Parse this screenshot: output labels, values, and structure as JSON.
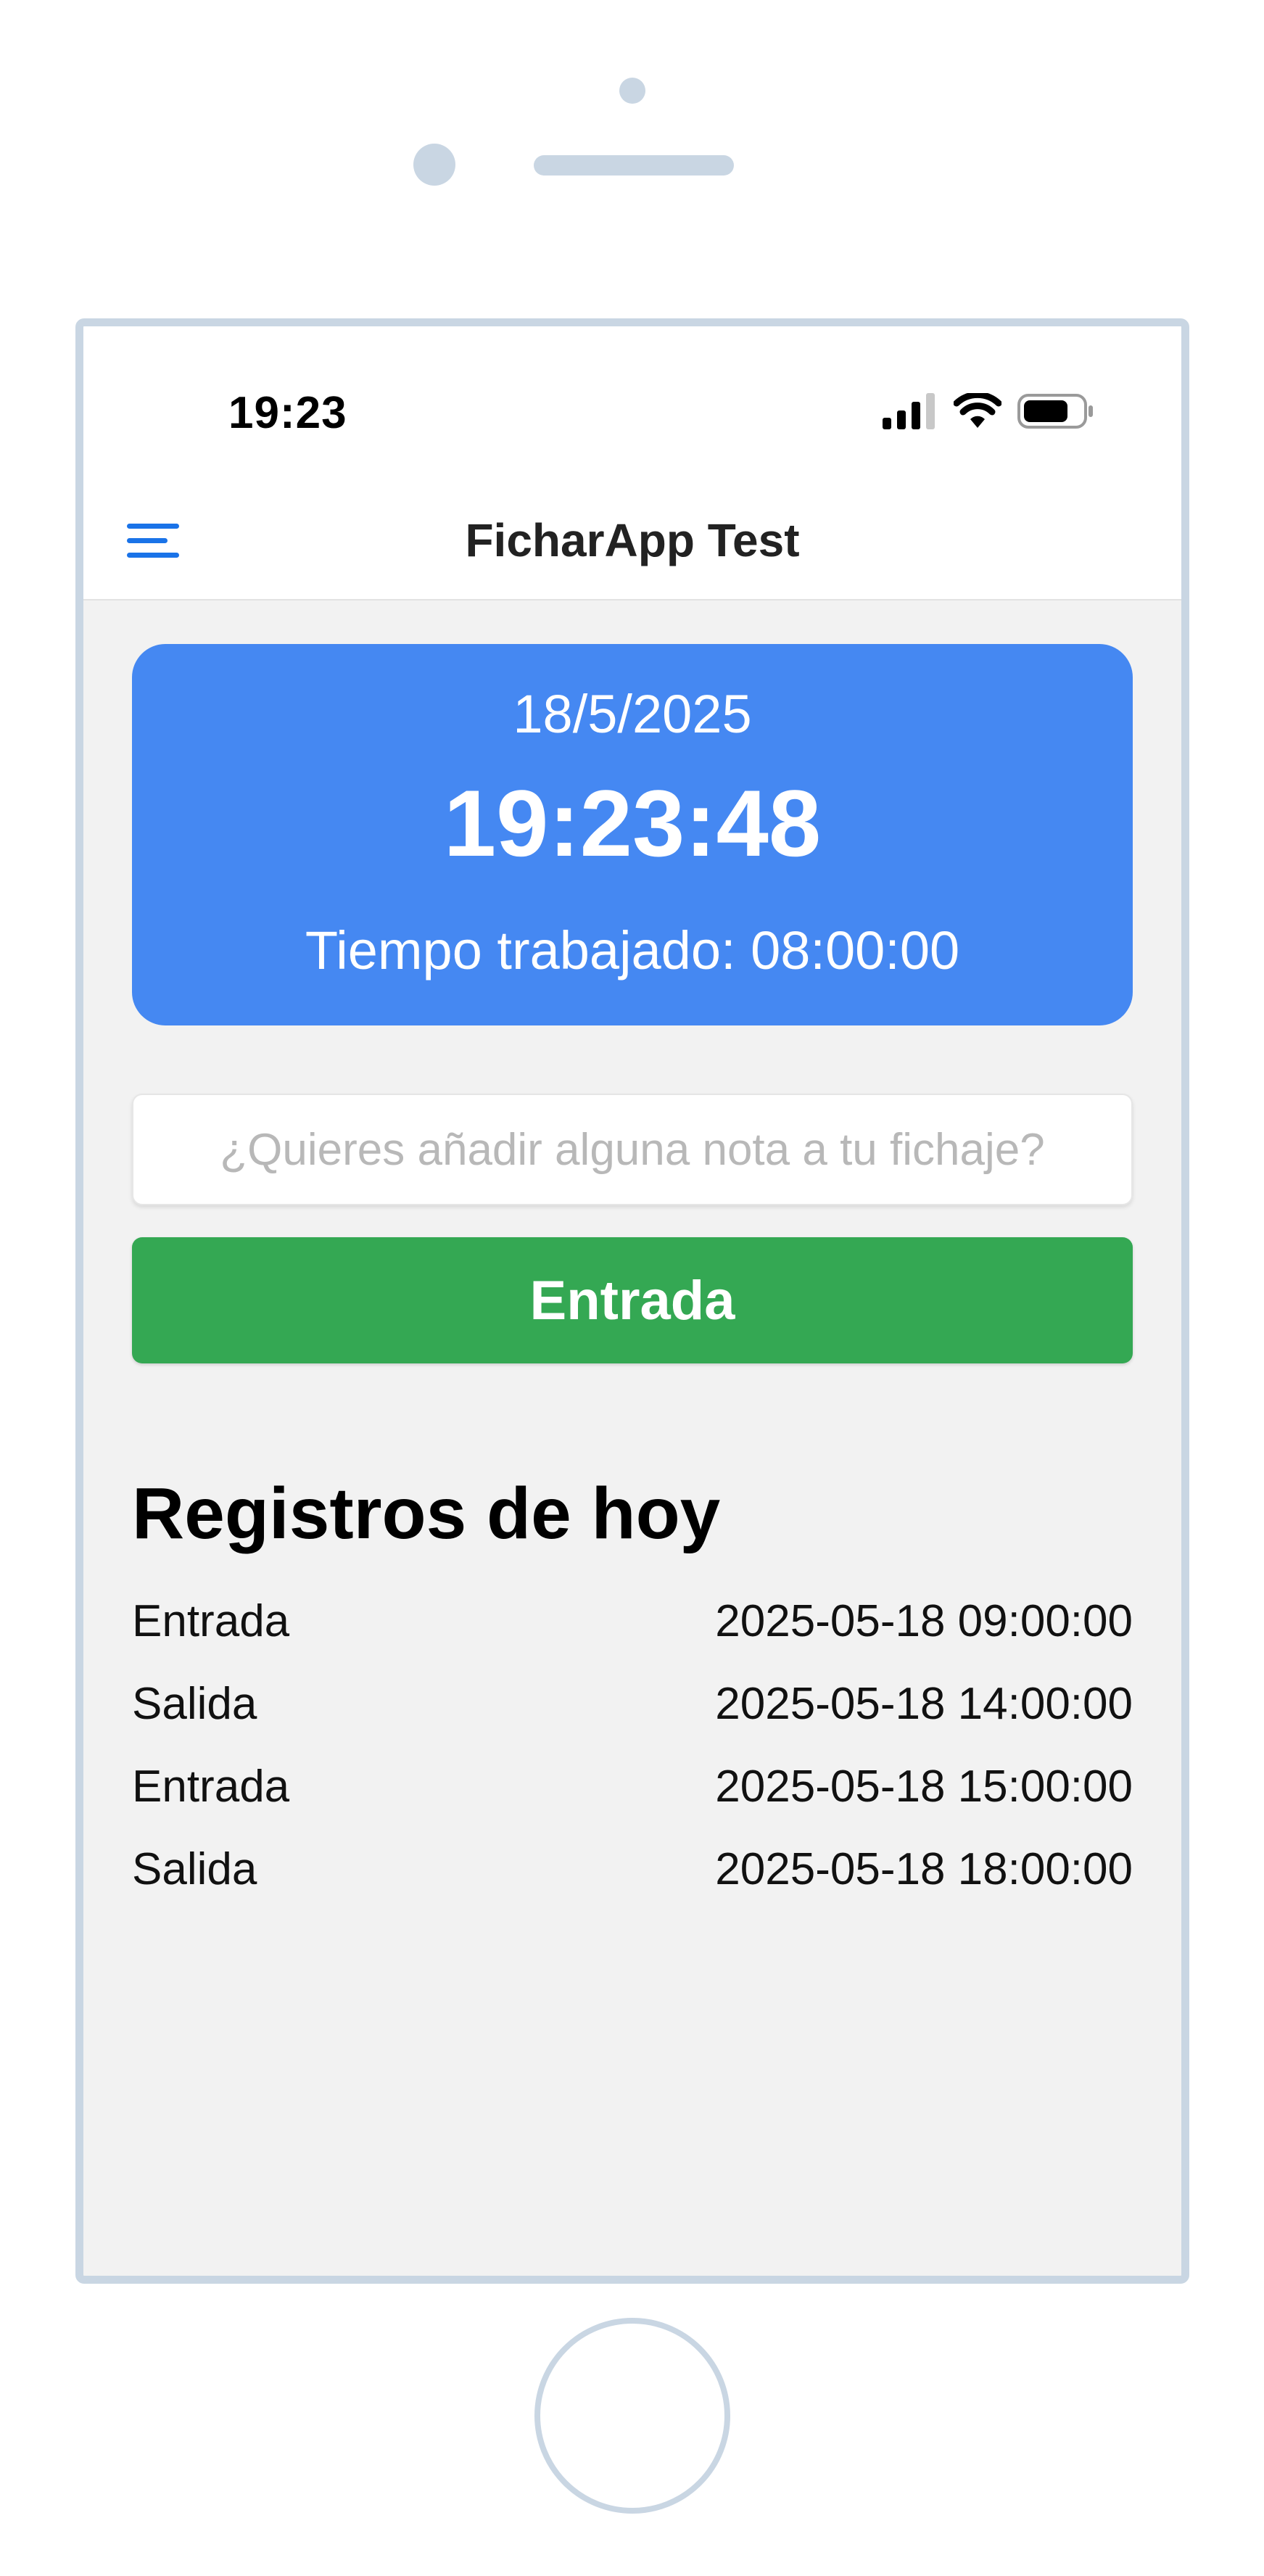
{
  "status_bar": {
    "time": "19:23"
  },
  "nav": {
    "title": "FicharApp Test"
  },
  "clock": {
    "date": "18/5/2025",
    "time": "19:23:48",
    "worked_label": "Tiempo trabajado: 08:00:00"
  },
  "note": {
    "placeholder": "¿Quieres añadir alguna nota a tu fichaje?",
    "value": ""
  },
  "actions": {
    "clock_button_label": "Entrada"
  },
  "records": {
    "title": "Registros de hoy",
    "items": [
      {
        "type": "Entrada",
        "timestamp": "2025-05-18 09:00:00"
      },
      {
        "type": "Salida",
        "timestamp": "2025-05-18 14:00:00"
      },
      {
        "type": "Entrada",
        "timestamp": "2025-05-18 15:00:00"
      },
      {
        "type": "Salida",
        "timestamp": "2025-05-18 18:00:00"
      }
    ]
  },
  "colors": {
    "primary_blue": "#4588f2",
    "accent_green": "#34a853",
    "menu_blue": "#1a73e8",
    "frame": "#c9d6e3",
    "background": "#f2f2f2"
  },
  "icons": {
    "menu": "menu-icon",
    "signal": "cellular-signal-icon",
    "wifi": "wifi-icon",
    "battery": "battery-icon"
  }
}
